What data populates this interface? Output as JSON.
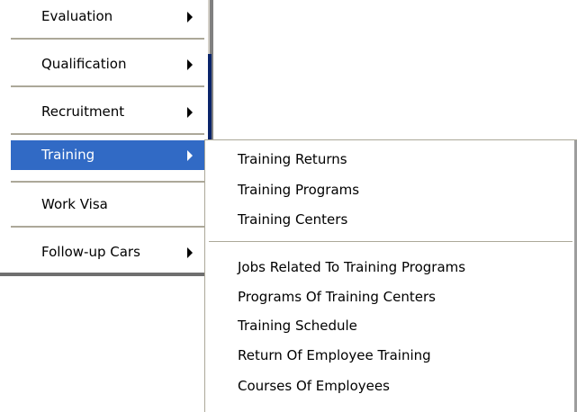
{
  "main_menu": {
    "items": [
      {
        "label": "Evaluation",
        "has_submenu": true,
        "selected": false
      },
      {
        "label": "Qualification",
        "has_submenu": true,
        "selected": false
      },
      {
        "label": "Recruitment",
        "has_submenu": true,
        "selected": false
      },
      {
        "label": "Training",
        "has_submenu": true,
        "selected": true
      },
      {
        "label": "Work Visa",
        "has_submenu": false,
        "selected": false
      },
      {
        "label": "Follow-up Cars",
        "has_submenu": true,
        "selected": false
      }
    ],
    "selection_color": "#316ac5"
  },
  "sub_menu": {
    "group1": [
      {
        "label": "Training Returns"
      },
      {
        "label": "Training Programs"
      },
      {
        "label": "Training Centers"
      }
    ],
    "group2": [
      {
        "label": "Jobs Related To Training Programs"
      },
      {
        "label": "Programs Of Training Centers"
      },
      {
        "label": "Training Schedule"
      },
      {
        "label": "Return Of Employee Training"
      },
      {
        "label": "Courses Of Employees"
      }
    ]
  },
  "icons": {
    "submenu_arrow": "chevron-right-icon"
  }
}
